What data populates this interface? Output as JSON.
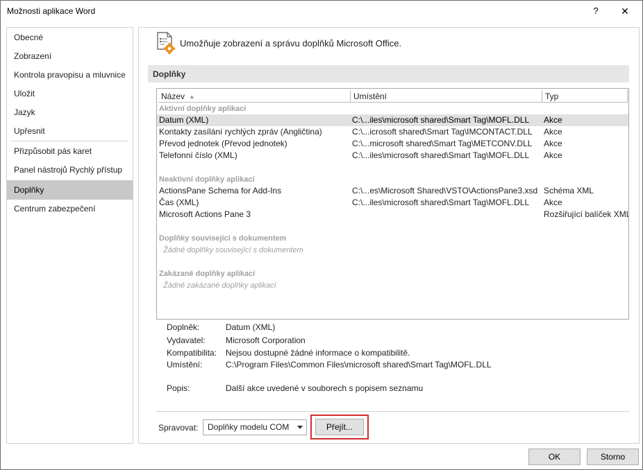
{
  "window": {
    "title": "Možnosti aplikace Word",
    "help_glyph": "?",
    "close_glyph": "✕"
  },
  "sidebar": {
    "items": [
      {
        "label": "Obecné"
      },
      {
        "label": "Zobrazení"
      },
      {
        "label": "Kontrola pravopisu a mluvnice"
      },
      {
        "label": "Uložit"
      },
      {
        "label": "Jazyk"
      },
      {
        "label": "Upřesnit"
      },
      {
        "label": "Přizpůsobit pás karet"
      },
      {
        "label": "Panel nástrojů Rychlý přístup"
      },
      {
        "label": "Doplňky",
        "active": true
      },
      {
        "label": "Centrum zabezpečení"
      }
    ]
  },
  "header": {
    "text": "Umožňuje zobrazení a správu doplňků Microsoft Office.",
    "icon": "addins-gear-icon"
  },
  "section": {
    "title": "Doplňky"
  },
  "grid": {
    "columns": {
      "name": "Název",
      "sort_glyph": "▲",
      "location": "Umístění",
      "type": "Typ"
    },
    "groups": {
      "active": {
        "label": "Aktivní doplňky aplikací",
        "rows": [
          {
            "name": "Datum (XML)",
            "location": "C:\\...iles\\microsoft shared\\Smart Tag\\MOFL.DLL",
            "type": "Akce",
            "selected": true
          },
          {
            "name": "Kontakty zasílání rychlých zpráv (Angličtina)",
            "location": "C:\\...icrosoft shared\\Smart Tag\\IMCONTACT.DLL",
            "type": "Akce"
          },
          {
            "name": "Převod jednotek (Převod jednotek)",
            "location": "C:\\...microsoft shared\\Smart Tag\\METCONV.DLL",
            "type": "Akce"
          },
          {
            "name": "Telefonní číslo (XML)",
            "location": "C:\\...iles\\microsoft shared\\Smart Tag\\MOFL.DLL",
            "type": "Akce"
          }
        ]
      },
      "inactive": {
        "label": "Neaktivní doplňky aplikací",
        "rows": [
          {
            "name": "ActionsPane Schema for Add-Ins",
            "location": "C:\\...es\\Microsoft Shared\\VSTO\\ActionsPane3.xsd",
            "type": "Schéma XML"
          },
          {
            "name": "Čas (XML)",
            "location": "C:\\...iles\\microsoft shared\\Smart Tag\\MOFL.DLL",
            "type": "Akce"
          },
          {
            "name": "Microsoft Actions Pane 3",
            "location": "",
            "type": "Rozšiřující balíček XML"
          }
        ]
      },
      "document": {
        "label": "Doplňky související s dokumentem",
        "empty": "Žádné doplňky související s dokumentem"
      },
      "disabled": {
        "label": "Zakázané doplňky aplikací",
        "empty": "Žádné zakázané doplňky aplikací"
      }
    }
  },
  "details": {
    "addin": {
      "label": "Doplněk:",
      "value": "Datum (XML)"
    },
    "publisher": {
      "label": "Vydavatel:",
      "value": "Microsoft Corporation"
    },
    "compatibility": {
      "label": "Kompatibilita:",
      "value": "Nejsou dostupné žádné informace o kompatibilitě."
    },
    "location": {
      "label": "Umístění:",
      "value": "C:\\Program Files\\Common Files\\microsoft shared\\Smart Tag\\MOFL.DLL"
    },
    "description": {
      "label": "Popis:",
      "value": "Další akce uvedené v souborech s popisem seznamu"
    }
  },
  "manage": {
    "label": "Spravovat:",
    "selected": "Doplňky modelu COM",
    "go_label": "Přejít..."
  },
  "footer": {
    "ok_label": "OK",
    "cancel_label": "Storno"
  },
  "colors": {
    "highlight": "#d32d2d",
    "selected_nav": "#c8c8c8",
    "selected_row": "#e1e1e1",
    "group_label": "#a0a0a0",
    "icon_accent": "#e8931f"
  }
}
